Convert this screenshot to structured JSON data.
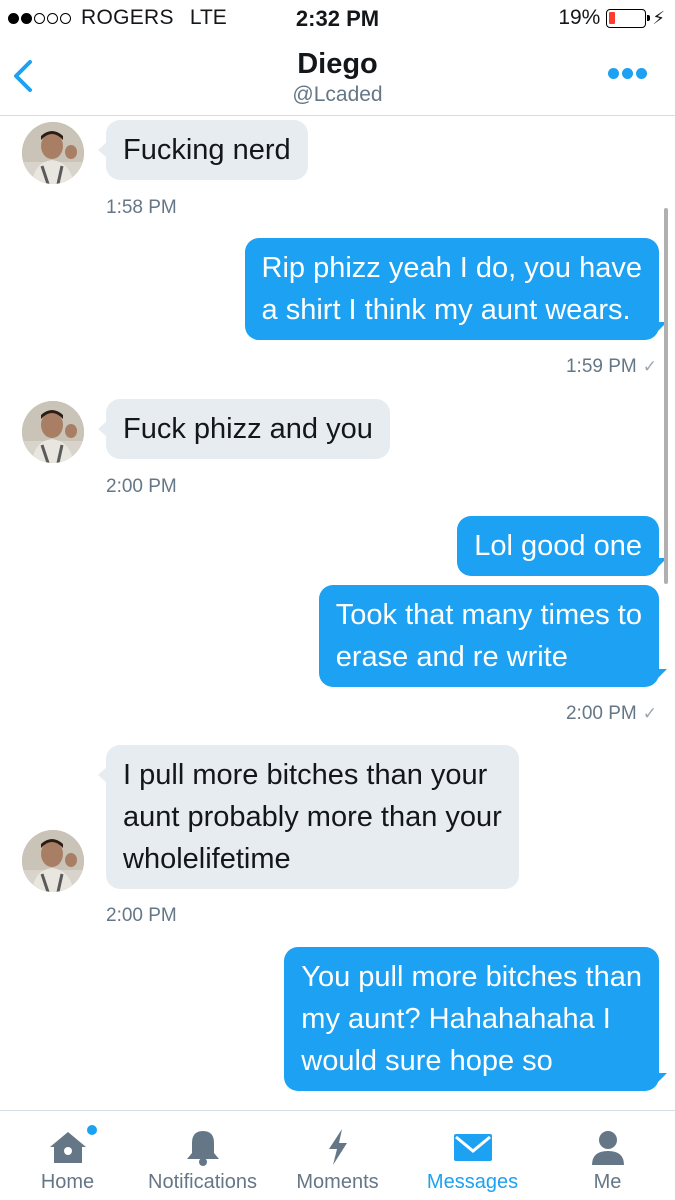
{
  "status_bar": {
    "carrier": "ROGERS",
    "network": "LTE",
    "time": "2:32 PM",
    "battery_percent": "19%",
    "battery_level": 0.19,
    "signal_bars_filled": 2,
    "signal_bars_total": 5
  },
  "header": {
    "name": "Diego",
    "handle": "@Lcaded"
  },
  "messages": [
    {
      "direction": "received",
      "text": "Fucking nerd",
      "time": "1:58 PM"
    },
    {
      "direction": "sent",
      "text": "Rip phizz yeah I do, you have\na shirt I think my aunt wears.",
      "time": "1:59 PM"
    },
    {
      "direction": "received",
      "text": "Fuck phizz and you",
      "time": "2:00 PM"
    },
    {
      "direction": "sent",
      "text": "Lol good one"
    },
    {
      "direction": "sent",
      "text": "Took that many times to\nerase and re write",
      "time": "2:00 PM"
    },
    {
      "direction": "received",
      "text": "I pull more bitches than your\naunt probably more than your\nwholelifetime",
      "time": "2:00 PM"
    },
    {
      "direction": "sent",
      "text": "You pull more bitches than\nmy aunt? Hahahahaha I\nwould sure hope so"
    }
  ],
  "tabs": [
    {
      "label": "Home",
      "icon": "home-icon",
      "badge": true
    },
    {
      "label": "Notifications",
      "icon": "bell-icon"
    },
    {
      "label": "Moments",
      "icon": "lightning-icon"
    },
    {
      "label": "Messages",
      "icon": "envelope-icon",
      "active": true
    },
    {
      "label": "Me",
      "icon": "person-icon"
    }
  ],
  "colors": {
    "accent": "#1da1f2",
    "received_bubble": "#e6ecf0",
    "muted_text": "#657786"
  }
}
